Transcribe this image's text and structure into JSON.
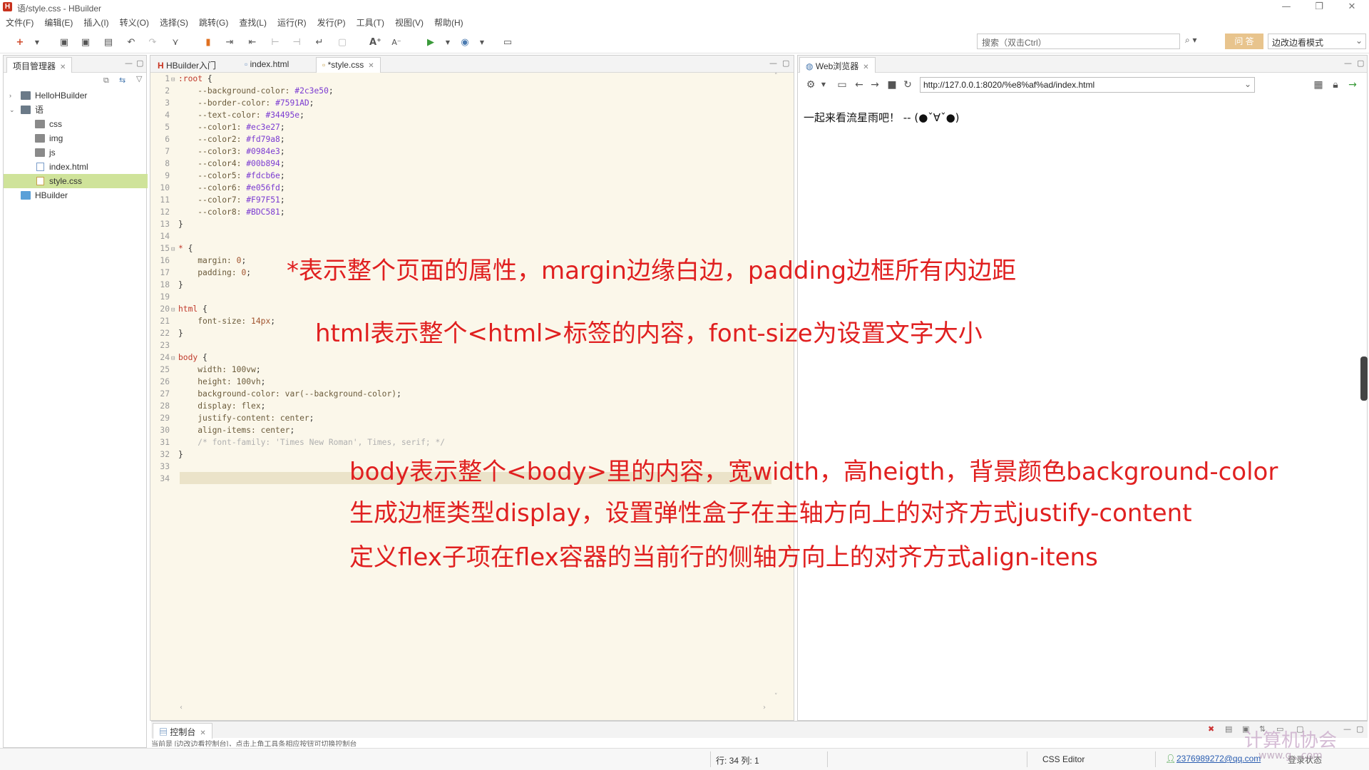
{
  "window": {
    "title": "语/style.css - HBuilder",
    "logo_letter": "H",
    "minimize": "—",
    "restore": "❐",
    "close": "✕"
  },
  "menu": [
    "文件(F)",
    "编辑(E)",
    "插入(I)",
    "转义(O)",
    "选择(S)",
    "跳转(G)",
    "查找(L)",
    "运行(R)",
    "发行(P)",
    "工具(T)",
    "视图(V)",
    "帮助(H)"
  ],
  "toolbar": {
    "search_placeholder": "搜索（双击Ctrl）",
    "search_icon": "search-icon",
    "ask_label": "问 答",
    "mode_label": "边改边看模式"
  },
  "project_panel": {
    "tab_label": "项目管理器",
    "tree": [
      {
        "label": "HelloHBuilder",
        "icon": "project-icon",
        "level": 0,
        "expanded": false
      },
      {
        "label": "语",
        "icon": "project-icon",
        "level": 0,
        "expanded": true
      },
      {
        "label": "css",
        "icon": "folder-icon",
        "level": 1
      },
      {
        "label": "img",
        "icon": "folder-icon",
        "level": 1
      },
      {
        "label": "js",
        "icon": "folder-icon",
        "level": 1
      },
      {
        "label": "index.html",
        "icon": "html-file-icon",
        "level": 1
      },
      {
        "label": "style.css",
        "icon": "css-file-icon",
        "level": 1,
        "selected": true
      },
      {
        "label": "HBuilder",
        "icon": "hbuilder-folder-icon",
        "level": 0
      }
    ]
  },
  "editor": {
    "tabs": [
      {
        "label": "HBuilder入门",
        "icon": "hbuilder-icon"
      },
      {
        "label": "index.html",
        "icon": "html-file-icon"
      },
      {
        "label": "*style.css",
        "icon": "css-file-icon",
        "active": true
      }
    ],
    "lines": [
      {
        "n": "1",
        "fold": "⊟",
        "html": "<span class='sel'>:root</span> <span class='brace'>{</span>"
      },
      {
        "n": "2",
        "html": "    <span class='prop'>--background-color:</span> <span class='pval'>#2c3e50</span>;"
      },
      {
        "n": "3",
        "html": "    <span class='prop'>--border-color:</span> <span class='pval'>#7591AD</span>;"
      },
      {
        "n": "4",
        "html": "    <span class='prop'>--text-color:</span> <span class='pval'>#34495e</span>;"
      },
      {
        "n": "5",
        "html": "    <span class='prop'>--color1:</span> <span class='pval'>#ec3e27</span>;"
      },
      {
        "n": "6",
        "html": "    <span class='prop'>--color2:</span> <span class='pval'>#fd79a8</span>;"
      },
      {
        "n": "7",
        "html": "    <span class='prop'>--color3:</span> <span class='pval'>#0984e3</span>;"
      },
      {
        "n": "8",
        "html": "    <span class='prop'>--color4:</span> <span class='pval'>#00b894</span>;"
      },
      {
        "n": "9",
        "html": "    <span class='prop'>--color5:</span> <span class='pval'>#fdcb6e</span>;"
      },
      {
        "n": "10",
        "html": "    <span class='prop'>--color6:</span> <span class='pval'>#e056fd</span>;"
      },
      {
        "n": "11",
        "html": "    <span class='prop'>--color7:</span> <span class='pval'>#F97F51</span>;"
      },
      {
        "n": "12",
        "html": "    <span class='prop'>--color8:</span> <span class='pval'>#BDC581</span>;"
      },
      {
        "n": "13",
        "html": "<span class='brace'>}</span>"
      },
      {
        "n": "14",
        "html": ""
      },
      {
        "n": "15",
        "fold": "⊟",
        "html": "<span class='sel'>*</span> <span class='brace'>{</span>"
      },
      {
        "n": "16",
        "html": "    <span class='prop'>margin:</span> <span class='pnum'>0</span>;"
      },
      {
        "n": "17",
        "html": "    <span class='prop'>padding:</span> <span class='pnum'>0</span>;"
      },
      {
        "n": "18",
        "html": "<span class='brace'>}</span>"
      },
      {
        "n": "19",
        "html": ""
      },
      {
        "n": "20",
        "fold": "⊟",
        "html": "<span class='sel'>html</span> <span class='brace'>{</span>"
      },
      {
        "n": "21",
        "html": "    <span class='prop'>font-size:</span> <span class='pnum'>14px</span>;"
      },
      {
        "n": "22",
        "html": "<span class='brace'>}</span>"
      },
      {
        "n": "23",
        "html": ""
      },
      {
        "n": "24",
        "fold": "⊟",
        "html": "<span class='sel'>body</span> <span class='brace'>{</span>"
      },
      {
        "n": "25",
        "html": "    <span class='prop'>width:</span> <span class='pln'>100vw</span>;"
      },
      {
        "n": "26",
        "html": "    <span class='prop'>height:</span> <span class='pln'>100vh</span>;"
      },
      {
        "n": "27",
        "html": "    <span class='prop'>background-color:</span> <span class='pln'>var(--background-color)</span>;"
      },
      {
        "n": "28",
        "html": "    <span class='prop'>display:</span> <span class='pln'>flex</span>;"
      },
      {
        "n": "29",
        "html": "    <span class='prop'>justify-content:</span> <span class='pln'>center</span>;"
      },
      {
        "n": "30",
        "html": "    <span class='prop'>align-items:</span> <span class='pln'>center</span>;"
      },
      {
        "n": "31",
        "html": "    <span class='cmt'>/* font-family: 'Times New Roman', Times, serif; */</span>"
      },
      {
        "n": "32",
        "html": "<span class='brace'>}</span>"
      },
      {
        "n": "33",
        "html": ""
      },
      {
        "n": "34",
        "html": ""
      }
    ]
  },
  "annotations": [
    "*表示整个页面的属性，margin边缘白边，padding边框所有内边距",
    "html表示整个<html>标签的内容，font-size为设置文字大小",
    "body表示整个<body>里的内容，宽width，高heigth，背景颜色background-color",
    "生成边框类型display，设置弹性盒子在主轴方向上的对齐方式justify-content",
    "定义flex子项在flex容器的当前行的侧轴方向上的对齐方式align-itens"
  ],
  "browser": {
    "tab_label": "Web浏览器",
    "url": "http://127.0.0.1:8020/%e8%af%ad/index.html",
    "page_text": "一起来看流星雨吧！ -- (●ˇ∀ˇ●)"
  },
  "console": {
    "tab_label": "控制台",
    "text": "当前是 [边改边看控制台]，点击上角工具条相应按钮可切换控制台"
  },
  "statusbar": {
    "position": "行: 34 列: 1",
    "editor_type": "CSS Editor",
    "user": "2376989272@qq.com",
    "login_label": "登录状态"
  },
  "watermark": {
    "line1": "计算机协会",
    "line2": "www.g...com"
  },
  "colors": {
    "annotation": "#e02020",
    "editor_bg": "#fbf7ea",
    "selected_file": "#cfe39a",
    "ask_button": "#e8c48d"
  }
}
